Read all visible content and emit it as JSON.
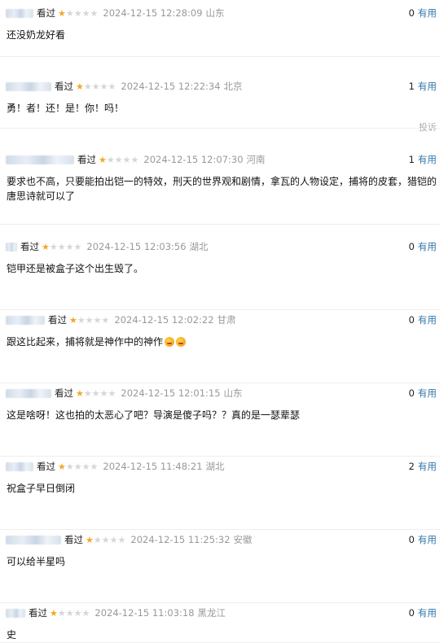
{
  "comments": [
    {
      "watched": "看过",
      "rating": 1,
      "time": "2024-12-15 12:28:09",
      "location": "山东",
      "useful_count": "0",
      "useful_label": "有用",
      "text": "还没奶龙好看"
    },
    {
      "watched": "看过",
      "rating": 1,
      "time": "2024-12-15 12:22:34",
      "location": "北京",
      "useful_count": "1",
      "useful_label": "有用",
      "text": "勇！者！还！是！你！吗！",
      "report": "投诉"
    },
    {
      "watched": "看过",
      "rating": 1,
      "time": "2024-12-15 12:07:30",
      "location": "河南",
      "useful_count": "1",
      "useful_label": "有用",
      "text": "要求也不高，只要能拍出铠一的特效，刑天的世界观和剧情，拿瓦的人物设定，捕将的皮套，猎铠的唐思诗就可以了"
    },
    {
      "watched": "看过",
      "rating": 1,
      "time": "2024-12-15 12:03:56",
      "location": "湖北",
      "useful_count": "0",
      "useful_label": "有用",
      "text": "铠甲还是被盒子这个出生毁了。"
    },
    {
      "watched": "看过",
      "rating": 1,
      "time": "2024-12-15 12:02:22",
      "location": "甘肃",
      "useful_count": "0",
      "useful_label": "有用",
      "text": "跟这比起来，捕将就是神作中的神作"
    },
    {
      "watched": "看过",
      "rating": 1,
      "time": "2024-12-15 12:01:15",
      "location": "山东",
      "useful_count": "0",
      "useful_label": "有用",
      "text": "这是啥呀！这也拍的太恶心了吧？导演是傻子吗？？真的是一瑟辈瑟"
    },
    {
      "watched": "看过",
      "rating": 1,
      "time": "2024-12-15 11:48:21",
      "location": "湖北",
      "useful_count": "2",
      "useful_label": "有用",
      "text": "祝盒子早日倒闭"
    },
    {
      "watched": "看过",
      "rating": 1,
      "time": "2024-12-15 11:25:32",
      "location": "安徽",
      "useful_count": "0",
      "useful_label": "有用",
      "text": "可以给半星吗"
    },
    {
      "watched": "看过",
      "rating": 1,
      "time": "2024-12-15 11:03:18",
      "location": "黑龙江",
      "useful_count": "0",
      "useful_label": "有用",
      "text": "史"
    }
  ]
}
